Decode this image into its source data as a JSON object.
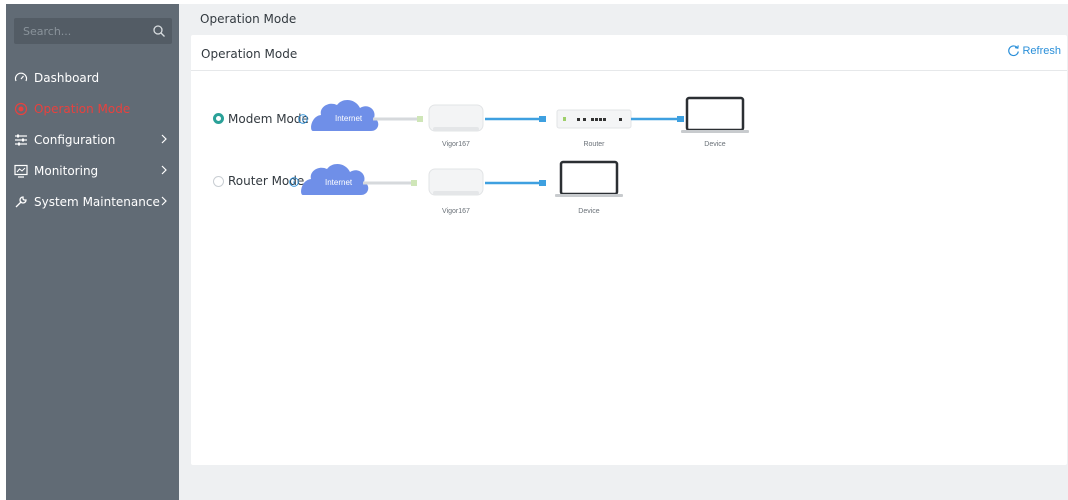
{
  "sidebar": {
    "search_placeholder": "Search...",
    "items": [
      {
        "label": "Dashboard",
        "icon": "gauge-icon",
        "active": false,
        "has_arrow": false
      },
      {
        "label": "Operation Mode",
        "icon": "target-icon",
        "active": true,
        "has_arrow": false
      },
      {
        "label": "Configuration",
        "icon": "sliders-icon",
        "active": false,
        "has_arrow": true
      },
      {
        "label": "Monitoring",
        "icon": "monitor-icon",
        "active": false,
        "has_arrow": true
      },
      {
        "label": "System Maintenance",
        "icon": "wrench-icon",
        "active": false,
        "has_arrow": true
      }
    ]
  },
  "breadcrumb": "Operation Mode",
  "card": {
    "title": "Operation Mode",
    "refresh_label": "Refresh"
  },
  "modes": [
    {
      "label": "Modem Mode",
      "selected": true,
      "cloud": "Internet",
      "captions": [
        "Vigor167",
        "Router",
        "Device"
      ]
    },
    {
      "label": "Router Mode",
      "selected": false,
      "cloud": "Internet",
      "captions": [
        "Vigor167",
        "Device"
      ]
    }
  ],
  "colors": {
    "sidebar_bg": "#616b75",
    "active": "#e8413e",
    "accent": "#2a8fd9",
    "radio_on": "#2aa198",
    "cloud": "#6f8fe8",
    "cable": "#3ea0e0"
  }
}
